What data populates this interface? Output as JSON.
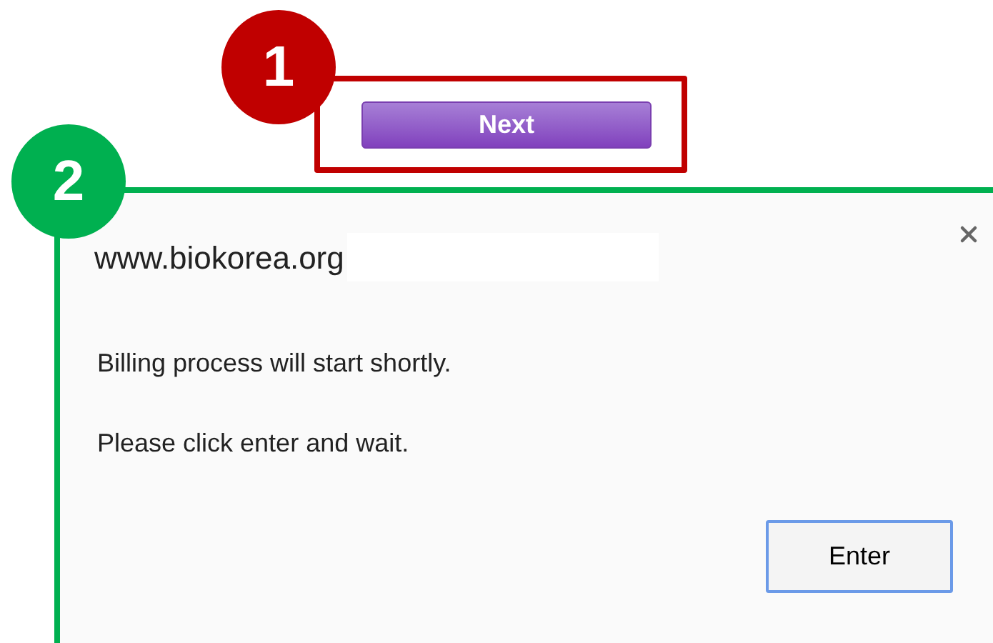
{
  "annotations": [
    {
      "label": "1",
      "color": "#c00000"
    },
    {
      "label": "2",
      "color": "#00b050"
    }
  ],
  "next_button": {
    "label": "Next"
  },
  "dialog": {
    "title": "www.biokorea.org",
    "messages": [
      "Billing process will start shortly.",
      "Please click enter and wait."
    ],
    "button": "Enter"
  }
}
